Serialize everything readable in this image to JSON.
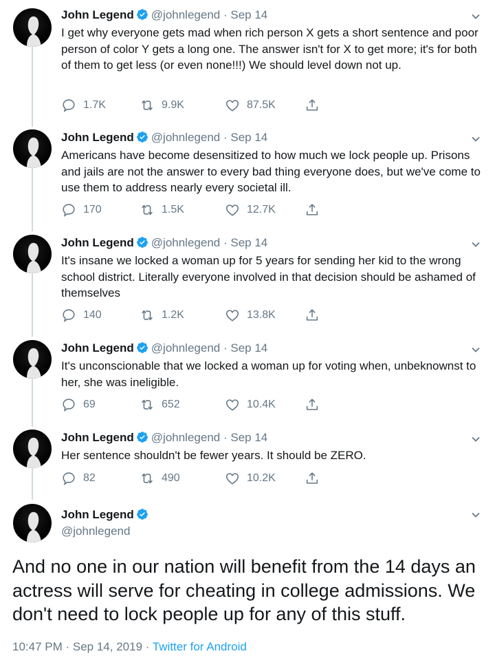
{
  "colors": {
    "verified": "#1da1f2",
    "muted": "#657786",
    "link": "#1da1f2"
  },
  "icons": [
    "verified-badge-icon",
    "chevron-down-icon",
    "reply-icon",
    "retweet-icon",
    "like-icon",
    "share-icon"
  ],
  "tweets": [
    {
      "name": "John Legend",
      "handle": "@johnlegend",
      "sep": "·",
      "date": "Sep 14",
      "text": "I get why everyone gets mad when rich person X gets a short sentence and poor person of color Y gets a long one. The answer isn't for X to get more; it's for both of them to get less (or even none!!!) We should level down not up.",
      "replies": "1.7K",
      "retweets": "9.9K",
      "likes": "87.5K"
    },
    {
      "name": "John Legend",
      "handle": "@johnlegend",
      "sep": "·",
      "date": "Sep 14",
      "text": "Americans have become desensitized to how much we lock people up. Prisons and jails are not the answer to every bad thing everyone does, but we've come to use them to address nearly every societal ill.",
      "replies": "170",
      "retweets": "1.5K",
      "likes": "12.7K"
    },
    {
      "name": "John Legend",
      "handle": "@johnlegend",
      "sep": "·",
      "date": "Sep 14",
      "text": "It's insane we locked a woman up for 5 years for sending her kid to the wrong school district.  Literally everyone involved in that decision should be ashamed of themselves",
      "replies": "140",
      "retweets": "1.2K",
      "likes": "13.8K"
    },
    {
      "name": "John Legend",
      "handle": "@johnlegend",
      "sep": "·",
      "date": "Sep 14",
      "text": "It's unconscionable that we locked a woman up for voting when, unbeknownst to her, she was ineligible.",
      "replies": "69",
      "retweets": "652",
      "likes": "10.4K"
    },
    {
      "name": "John Legend",
      "handle": "@johnlegend",
      "sep": "·",
      "date": "Sep 14",
      "text": "Her sentence shouldn't be fewer years. It should be ZERO.",
      "replies": "82",
      "retweets": "490",
      "likes": "10.2K"
    }
  ],
  "main_tweet": {
    "name": "John Legend",
    "handle": "@johnlegend",
    "text": "And no one in our nation will benefit from the 14 days an actress will serve for cheating in college admissions. We don't need to lock people up for any of this stuff.",
    "time": "10:47 PM · Sep 14, 2019 ·",
    "source": "Twitter for Android"
  }
}
